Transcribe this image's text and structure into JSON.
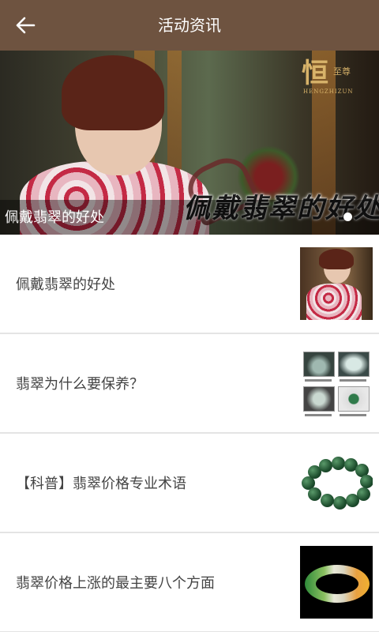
{
  "appbar": {
    "title": "活动资讯",
    "back_icon": "arrow-left-icon",
    "background": "#6e5340"
  },
  "banner": {
    "caption": "佩戴翡翠的好处",
    "overlay_text": "佩戴翡翠的好处",
    "brand_logo": {
      "big": "恒",
      "small": "至尊",
      "sub": "HENGZHIZUN"
    },
    "slide_indicator": "dot"
  },
  "news": [
    {
      "title": "佩戴翡翠的好处",
      "thumb": "woman-in-qipao"
    },
    {
      "title": "翡翠为什么要保养？",
      "thumb": "jade-care-steps"
    },
    {
      "title": "【科普】翡翠价格专业术语",
      "thumb": "jade-bead-bracelet"
    },
    {
      "title": "翡翠价格上涨的最主要八个方面",
      "thumb": "jade-bangle"
    }
  ]
}
